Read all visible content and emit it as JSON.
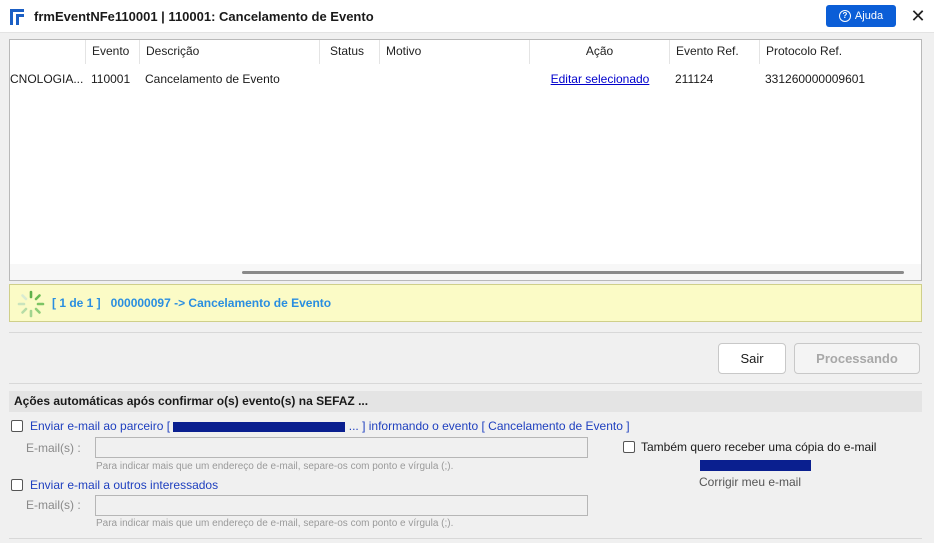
{
  "window": {
    "title": "frmEventNFe110001 | 110001: Cancelamento de Evento",
    "help_label": "Ajuda",
    "close_glyph": "✕"
  },
  "grid": {
    "columns": [
      "Evento",
      "Descrição",
      "Status",
      "Motivo",
      "Ação",
      "Evento Ref.",
      "Protocolo Ref."
    ],
    "rows": [
      {
        "partial": "CNOLOGIA...",
        "evento": "110001",
        "descricao": "Cancelamento de Evento",
        "status": "",
        "motivo": "",
        "acao": "Editar selecionado",
        "evento_ref": "211124",
        "protocolo_ref": "331260000009601"
      }
    ]
  },
  "status_bar": {
    "text": "[ 1 de 1 ]   000000097 -> Cancelamento de Evento"
  },
  "buttons": {
    "sair": "Sair",
    "processando": "Processando"
  },
  "auto_actions": {
    "title": "Ações automáticas após confirmar o(s) evento(s) na SEFAZ ...",
    "parceiro": {
      "prefix": "Enviar e-mail ao parceiro [",
      "suffix": "... ] informando o evento [ Cancelamento de Evento ]",
      "checked": false
    },
    "emails_label": "E-mail(s) :",
    "emails_value": "",
    "hint": "Para indicar mais que um endereço de e-mail, separe-os com ponto e vírgula (;).",
    "copia_label": "Também quero receber uma cópia do e-mail",
    "copia_checked": false,
    "corrigir_label": "Corrigir meu e-mail",
    "outros": {
      "label": "Enviar e-mail a outros interessados",
      "checked": false
    },
    "emails2_label": "E-mail(s) :",
    "emails2_value": "",
    "hint2": "Para indicar mais que um endereço de e-mail, separe-os com ponto e vírgula (;)."
  },
  "colors": {
    "accent": "#0b5ed7",
    "status_bg": "#fbfbc6",
    "status_text": "#2a8ee0",
    "link": "#0000cc",
    "redaction": "#0a1f8f"
  }
}
